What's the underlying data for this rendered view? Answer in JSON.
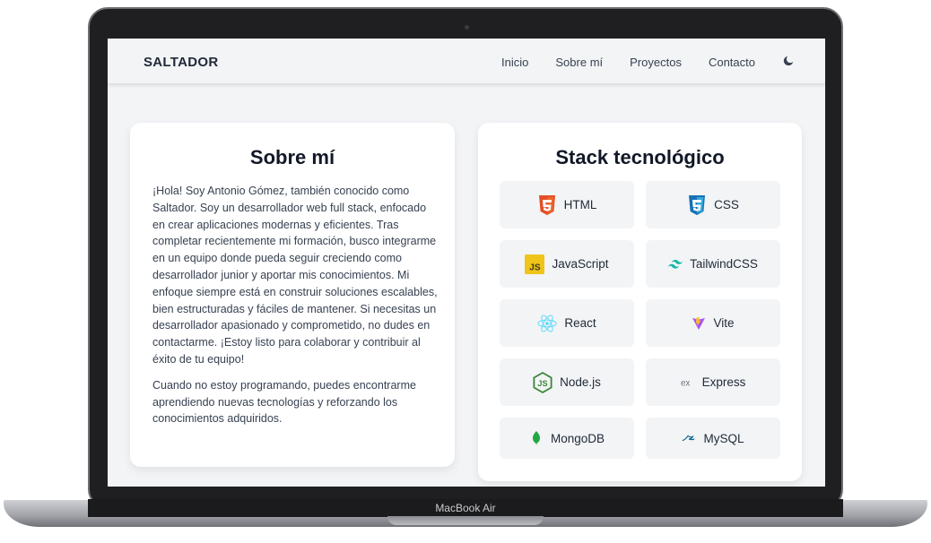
{
  "device": {
    "model_label": "MacBook Air"
  },
  "navbar": {
    "brand": "SALTADOR",
    "links": [
      "Inicio",
      "Sobre mí",
      "Proyectos",
      "Contacto"
    ],
    "theme_icon": "moon-icon"
  },
  "about": {
    "title": "Sobre mí",
    "paragraph1": "¡Hola! Soy Antonio Gómez, también conocido como Saltador. Soy un desarrollador web full stack, enfocado en crear aplicaciones modernas y eficientes. Tras completar recientemente mi formación, busco integrarme en un equipo donde pueda seguir creciendo como desarrollador junior y aportar mis conocimientos. Mi enfoque siempre está en construir soluciones escalables, bien estructuradas y fáciles de mantener. Si necesitas un desarrollador apasionado y comprometido, no dudes en contactarme. ¡Estoy listo para colaborar y contribuir al éxito de tu equipo!",
    "paragraph2": "Cuando no estoy programando, puedes encontrarme aprendiendo nuevas tecnologías y reforzando los conocimientos adquiridos."
  },
  "stack": {
    "title": "Stack tecnológico",
    "items": [
      {
        "label": "HTML",
        "icon": "html5-icon",
        "color": "#e34f26"
      },
      {
        "label": "CSS",
        "icon": "css3-icon",
        "color": "#1572b6"
      },
      {
        "label": "JavaScript",
        "icon": "javascript-icon",
        "color": "#f0c419"
      },
      {
        "label": "TailwindCSS",
        "icon": "tailwind-icon",
        "color": "#14b8a6"
      },
      {
        "label": "React",
        "icon": "react-icon",
        "color": "#61dafb"
      },
      {
        "label": "Vite",
        "icon": "vite-icon",
        "color": "#a855f7"
      },
      {
        "label": "Node.js",
        "icon": "nodejs-icon",
        "color": "#3c873a"
      },
      {
        "label": "Express",
        "icon": "express-icon",
        "color": "#6b7280"
      },
      {
        "label": "MongoDB",
        "icon": "mongodb-icon",
        "color": "#22a745"
      },
      {
        "label": "MySQL",
        "icon": "mysql-icon",
        "color": "#00618a"
      }
    ]
  }
}
